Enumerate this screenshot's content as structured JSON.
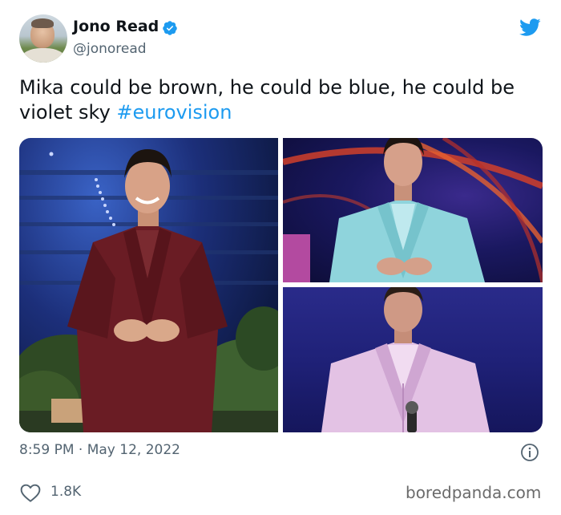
{
  "user": {
    "name": "Jono Read",
    "handle": "@jonoread"
  },
  "tweet": {
    "text": "Mika could be brown, he could be blue, he could be violet sky ",
    "hashtag": "#eurovision"
  },
  "meta": {
    "timestamp": "8:59 PM · May 12, 2022",
    "likes": "1.8K"
  },
  "watermark": "boredpanda.com",
  "colors": {
    "brand": "#1d9bf0",
    "text": "#0f1419",
    "secondary": "#536471"
  },
  "icons": [
    "verified-badge-icon",
    "twitter-bird-icon",
    "info-icon",
    "heart-icon"
  ]
}
